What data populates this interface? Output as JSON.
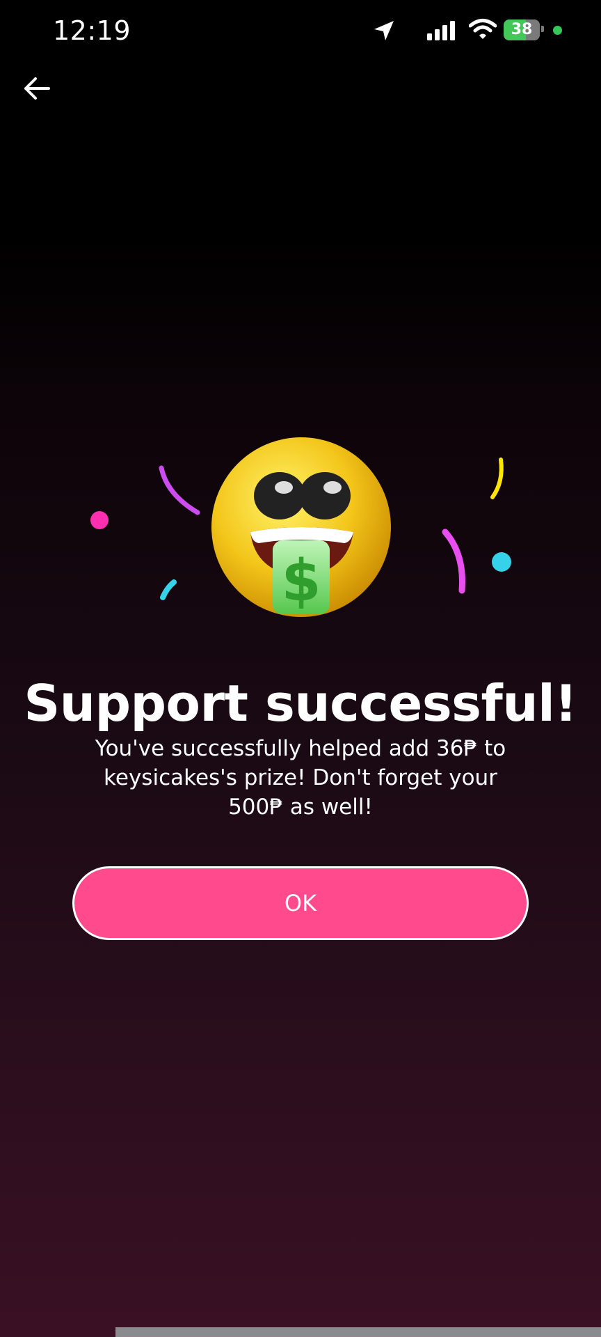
{
  "status_bar": {
    "time": "12:19",
    "battery_level": "38",
    "icons": [
      "location-arrow-icon",
      "cellular-signal-icon",
      "wifi-icon",
      "battery-charging-icon",
      "privacy-indicator-dot"
    ]
  },
  "header": {
    "back_icon": "arrow-left-icon"
  },
  "hero": {
    "emoji": "money-mouth-face-with-sunglasses",
    "confetti_colors": [
      "#e94ff0",
      "#ff2fb0",
      "#35d2ea",
      "#ffe600"
    ]
  },
  "main": {
    "title": "Support successful!",
    "message": "You've successfully helped add 36₱ to keysicakes's prize! Don't forget your 500₱ as well!",
    "ok_label": "OK"
  },
  "colors": {
    "accent": "#ff4a8d",
    "background_top": "#000000",
    "background_bottom": "#3a1024"
  }
}
